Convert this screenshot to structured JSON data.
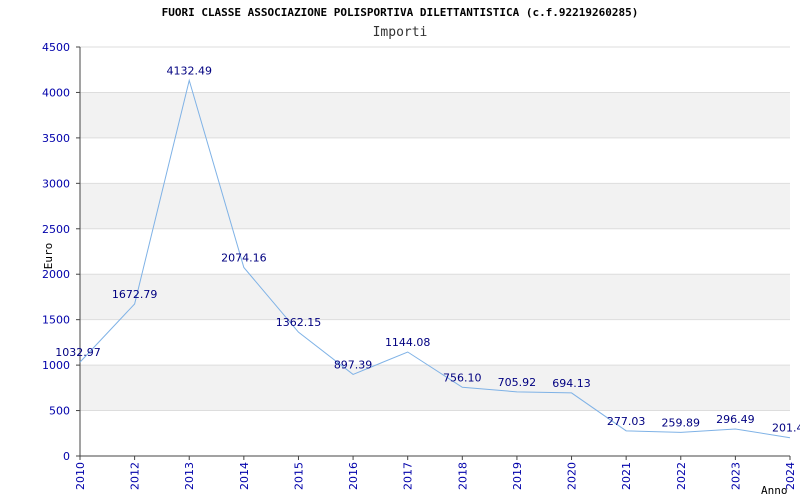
{
  "chart_data": {
    "type": "line",
    "title": "FUORI CLASSE ASSOCIAZIONE POLISPORTIVA DILETTANTISTICA (c.f.92219260285)",
    "subtitle": "Importi",
    "xlabel": "Anno",
    "ylabel": "Euro",
    "x": [
      "2010",
      "2012",
      "2013",
      "2014",
      "2015",
      "2016",
      "2017",
      "2018",
      "2019",
      "2020",
      "2021",
      "2022",
      "2023",
      "2024"
    ],
    "series": [
      {
        "values": [
          1032.97,
          1672.79,
          4132.49,
          2074.16,
          1362.15,
          897.39,
          1144.08,
          756.1,
          705.92,
          694.13,
          277.03,
          259.89,
          296.49,
          201.4
        ]
      }
    ],
    "labels": [
      "1032.97",
      "1672.79",
      "4132.49",
      "2074.16",
      "1362.15",
      "897.39",
      "1144.08",
      "756.10",
      "705.92",
      "694.13",
      "277.03",
      "259.89",
      "296.49",
      "201.4"
    ],
    "ylim": [
      0,
      4500
    ],
    "yticks": [
      "0",
      "500",
      "1000",
      "1500",
      "2000",
      "2500",
      "3000",
      "3500",
      "4000",
      "4500"
    ],
    "grid": true,
    "colors": {
      "line": "#7fb2e6",
      "band": "#f2f2f2",
      "tick": "#0000aa",
      "label": "#000080"
    }
  }
}
